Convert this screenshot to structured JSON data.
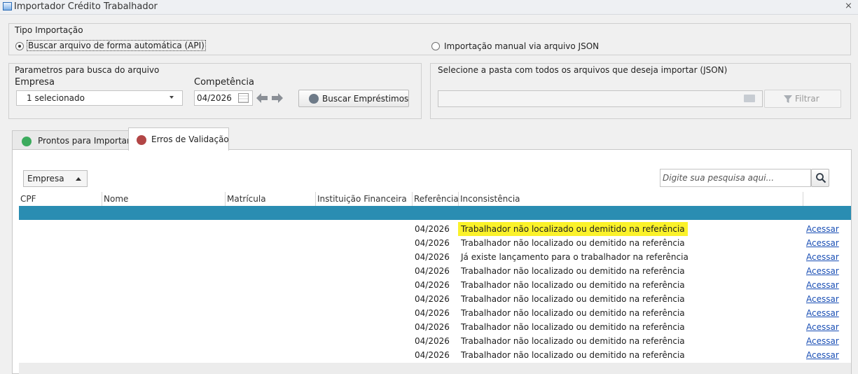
{
  "window": {
    "title": "Importador Crédito Trabalhador",
    "close_label": "ℵ"
  },
  "tipo_importacao": {
    "group_label": "Tipo Importação",
    "option_api": "Buscar arquivo de forma automática (API)",
    "option_json": "Importação manual via arquivo JSON",
    "selected": "api"
  },
  "parametros": {
    "group_label": "Parametros para busca do arquivo",
    "empresa_label": "Empresa",
    "empresa_value": "1 selecionado",
    "competencia_label": "Competência",
    "competencia_value": "04/2026",
    "buscar_button": "Buscar Empréstimos"
  },
  "pasta": {
    "group_label": "Selecione a pasta com todos os arquivos que deseja importar (JSON)",
    "path_value": "",
    "filtrar_button": "Filtrar"
  },
  "tabs": [
    {
      "label": "Prontos para Importar",
      "color": "#3cab5d",
      "active": false
    },
    {
      "label": "Erros de Validação",
      "color": "#b24646",
      "active": true
    }
  ],
  "grid": {
    "group_by_label": "Empresa",
    "search_placeholder": "Digite sua pesquisa aqui...",
    "columns": [
      "CPF",
      "Nome",
      "Matrícula",
      "Instituição Financeira",
      "Referência",
      "Inconsistência"
    ],
    "group_row_color": "#2a8db2",
    "highlight_color": "#fbf22a",
    "rows": [
      {
        "referencia": "04/2026",
        "inconsistencia": "Trabalhador não localizado ou demitido na referência",
        "acao": "Acessar",
        "highlight": true
      },
      {
        "referencia": "04/2026",
        "inconsistencia": "Trabalhador não localizado ou demitido na referência",
        "acao": "Acessar"
      },
      {
        "referencia": "04/2026",
        "inconsistencia": "Já existe lançamento para o trabalhador na referência",
        "acao": "Acessar"
      },
      {
        "referencia": "04/2026",
        "inconsistencia": "Trabalhador não localizado ou demitido na referência",
        "acao": "Acessar"
      },
      {
        "referencia": "04/2026",
        "inconsistencia": "Trabalhador não localizado ou demitido na referência",
        "acao": "Acessar"
      },
      {
        "referencia": "04/2026",
        "inconsistencia": "Trabalhador não localizado ou demitido na referência",
        "acao": "Acessar"
      },
      {
        "referencia": "04/2026",
        "inconsistencia": "Trabalhador não localizado ou demitido na referência",
        "acao": "Acessar"
      },
      {
        "referencia": "04/2026",
        "inconsistencia": "Trabalhador não localizado ou demitido na referência",
        "acao": "Acessar"
      },
      {
        "referencia": "04/2026",
        "inconsistencia": "Trabalhador não localizado ou demitido na referência",
        "acao": "Acessar"
      },
      {
        "referencia": "04/2026",
        "inconsistencia": "Trabalhador não localizado ou demitido na referência",
        "acao": "Acessar"
      }
    ]
  }
}
